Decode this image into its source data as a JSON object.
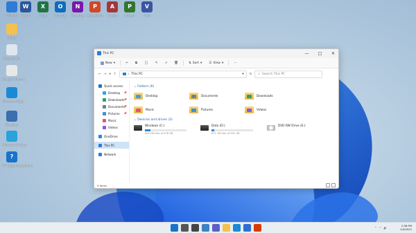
{
  "desktop_icons": [
    {
      "label": "This PC",
      "color": "#2f7bd6",
      "letter": ""
    },
    {
      "label": "Word",
      "color": "#2b579a",
      "letter": "W"
    },
    {
      "label": "Excel",
      "color": "#217346",
      "letter": "X"
    },
    {
      "label": "Outlook",
      "color": "#0f6cbd",
      "letter": "O"
    },
    {
      "label": "OneNote",
      "color": "#7719aa",
      "letter": "N"
    },
    {
      "label": "PowerPoint",
      "color": "#d24726",
      "letter": "P"
    },
    {
      "label": "Access",
      "color": "#a4373a",
      "letter": "A"
    },
    {
      "label": "Project",
      "color": "#31752f",
      "letter": "P"
    },
    {
      "label": "Visio",
      "color": "#3955a3",
      "letter": "V"
    },
    {
      "label": "Folder",
      "color": "#f2c14e",
      "letter": ""
    },
    {
      "label": "Recycle Bin",
      "color": "#dfe6ee",
      "letter": ""
    },
    {
      "label": "Google Chrome",
      "color": "#e8e8e8",
      "letter": ""
    },
    {
      "label": "Microsoft Edge",
      "color": "#1b8ad4",
      "letter": ""
    },
    {
      "label": "Windows",
      "color": "#3a6fb0",
      "letter": ""
    },
    {
      "label": "Windows Backup",
      "color": "#2aa3d8",
      "letter": ""
    },
    {
      "label": "HP Support Assistant",
      "color": "#1a73c8",
      "letter": "?"
    }
  ],
  "window": {
    "title": "This PC",
    "controls": {
      "minimize": "—",
      "maximize": "□",
      "close": "✕"
    },
    "toolbar": {
      "new": "New",
      "sort": "Sort",
      "view": "View",
      "more": "···"
    },
    "address": {
      "path": "This PC"
    },
    "search": {
      "placeholder": "Search This PC"
    },
    "nav": [
      {
        "label": "Quick access",
        "color": "#1a73c8",
        "active": false,
        "pinned": false
      },
      {
        "label": "Desktop",
        "color": "#3aa0e8",
        "active": false,
        "pinned": true
      },
      {
        "label": "Downloads",
        "color": "#27a36a",
        "active": false,
        "pinned": true
      },
      {
        "label": "Documents",
        "color": "#6d7f95",
        "active": false,
        "pinned": true
      },
      {
        "label": "Pictures",
        "color": "#3d8fd8",
        "active": false,
        "pinned": true
      },
      {
        "label": "Music",
        "color": "#e5556f",
        "active": false,
        "pinned": false
      },
      {
        "label": "Videos",
        "color": "#8a5ad8",
        "active": false,
        "pinned": false
      },
      {
        "label": "OneDrive",
        "color": "#1e88e5",
        "active": false,
        "pinned": false
      },
      {
        "label": "This PC",
        "color": "#2f7bd6",
        "active": true,
        "pinned": false
      },
      {
        "label": "Network",
        "color": "#2f7bd6",
        "active": false,
        "pinned": false
      }
    ],
    "folders_header": "Folders (6)",
    "folders": [
      {
        "label": "Desktop",
        "color": "#3aa0e8"
      },
      {
        "label": "Documents",
        "color": "#6d7f95"
      },
      {
        "label": "Downloads",
        "color": "#27a36a"
      },
      {
        "label": "Music",
        "color": "#e5556f"
      },
      {
        "label": "Pictures",
        "color": "#3d8fd8"
      },
      {
        "label": "Videos",
        "color": "#8a5ad8"
      }
    ],
    "drives_header": "Devices and drives (3)",
    "drives": [
      {
        "label": "Windows (C:)",
        "sub": "409 GB free of 476 GB",
        "used": 0.14,
        "type": "disk"
      },
      {
        "label": "Data (D:)",
        "sub": "871 GB free of 931 GB",
        "used": 0.06,
        "type": "disk"
      },
      {
        "label": "DVD RW Drive (E:)",
        "sub": "",
        "used": null,
        "type": "dvd"
      }
    ],
    "status": "9 items"
  },
  "taskbar": {
    "items": [
      {
        "name": "start",
        "color": "#1a73c8"
      },
      {
        "name": "search",
        "color": "#555"
      },
      {
        "name": "task-view",
        "color": "#444"
      },
      {
        "name": "widgets",
        "color": "#3b82c4"
      },
      {
        "name": "chat",
        "color": "#5b5fc7"
      },
      {
        "name": "file-explorer",
        "color": "#f2c14e"
      },
      {
        "name": "edge",
        "color": "#1b8ad4"
      },
      {
        "name": "store",
        "color": "#2f6fcf"
      },
      {
        "name": "office",
        "color": "#d83b01"
      }
    ],
    "time": "2:38 PM",
    "date": "1/4/2022"
  }
}
